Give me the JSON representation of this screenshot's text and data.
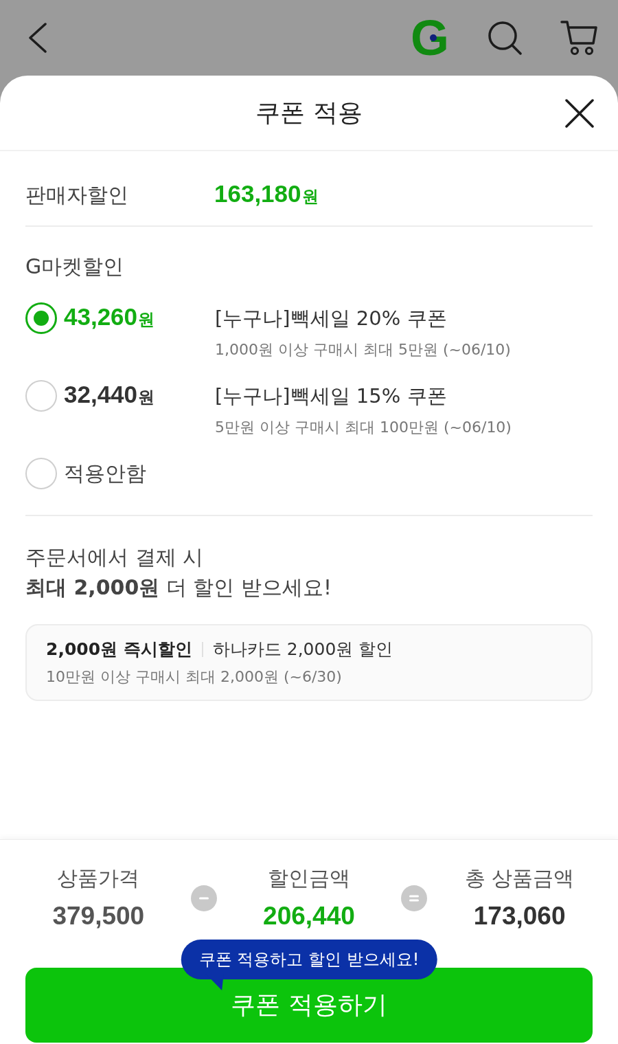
{
  "top_bar": {
    "logo": "G"
  },
  "sheet": {
    "title": "쿠폰 적용"
  },
  "seller_discount": {
    "label": "판매자할인",
    "amount": "163,180",
    "unit": "원"
  },
  "gmarket_discount": {
    "label": "G마켓할인",
    "options": [
      {
        "kind": "coupon",
        "selected": true,
        "amount": "43,260",
        "unit": "원",
        "title": "[누구나]빽세일 20% 쿠폰",
        "condition": "1,000원 이상 구매시 최대 5만원 (~06/10)"
      },
      {
        "kind": "coupon",
        "selected": false,
        "amount": "32,440",
        "unit": "원",
        "title": "[누구나]빽세일 15% 쿠폰",
        "condition": "5만원 이상 구매시 최대 100만원 (~06/10)"
      },
      {
        "kind": "none",
        "selected": false,
        "label": "적용안함"
      }
    ]
  },
  "payment_promo": {
    "line_1": "주문서에서 결제 시",
    "line_2": "**최대 2,000원** 더 할인 받으세요!",
    "card": {
      "headline": "2,000원 즉시할인",
      "detail": "하나카드 2,000원 할인",
      "condition": "10만원 이상 구매시 최대 2,000원 (~6/30)"
    }
  },
  "summary": {
    "price": {
      "label": "상품가격",
      "value": "379,500"
    },
    "discount": {
      "label": "할인금액",
      "value": "206,440"
    },
    "total": {
      "label": "총 상품금액",
      "value": "173,060"
    }
  },
  "tooltip": "쿠폰 적용하고 할인 받으세요!",
  "apply_button": "쿠폰 적용하기"
}
